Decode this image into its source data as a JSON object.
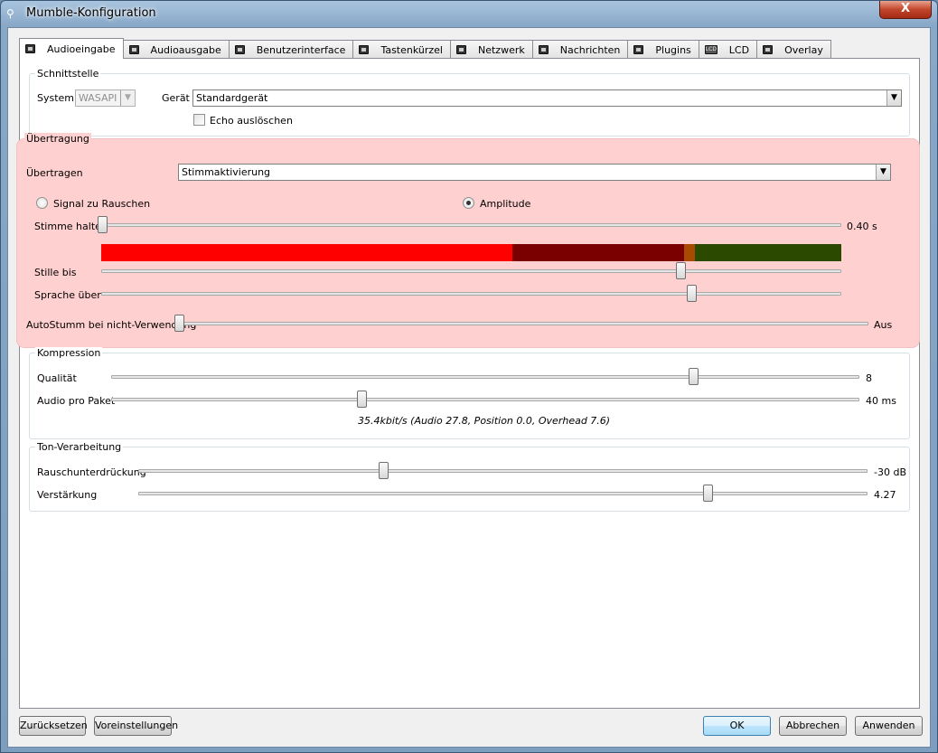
{
  "window": {
    "title": "Mumble-Konfiguration",
    "close_label": "X"
  },
  "tabs": [
    {
      "label": "Audioeingabe",
      "icon": "audio-input-icon"
    },
    {
      "label": "Audioausgabe",
      "icon": "audio-output-icon"
    },
    {
      "label": "Benutzerinterface",
      "icon": "window-icon"
    },
    {
      "label": "Tastenkürzel",
      "icon": "keyboard-icon"
    },
    {
      "label": "Netzwerk",
      "icon": "network-icon"
    },
    {
      "label": "Nachrichten",
      "icon": "messages-icon"
    },
    {
      "label": "Plugins",
      "icon": "plugin-icon"
    },
    {
      "label": "LCD",
      "icon": "lcd-icon",
      "icon_text": "LCD"
    },
    {
      "label": "Overlay",
      "icon": "overlay-icon"
    }
  ],
  "interface": {
    "title": "Schnittstelle",
    "system_label": "System",
    "system_value": "WASAPI",
    "device_label": "Gerät",
    "device_value": "Standardgerät",
    "echo_label": "Echo auslöschen",
    "echo_checked": false
  },
  "transmission": {
    "title": "Übertragung",
    "transmit_label": "Übertragen",
    "transmit_value": "Stimmaktivierung",
    "radio_snr": "Signal zu Rauschen",
    "radio_amplitude": "Amplitude",
    "selected": "amplitude",
    "hold_label": "Stimme halten",
    "hold_value": "0.40 s",
    "hold_fraction": 0.0,
    "vu_colors": [
      "#ff0000",
      "#7a0000",
      "#a84a00",
      "#2b4a00"
    ],
    "vu_stops": [
      0.555,
      0.788,
      0.802,
      1.0
    ],
    "silence_label": "Stille bis",
    "silence_fraction": 0.783,
    "speech_label": "Sprache über",
    "speech_fraction": 0.798,
    "automute_label": "AutoStumm bei nicht-Verwendung",
    "automute_value": "Aus",
    "automute_fraction": 0.0,
    "highlight_color": "#ffd0d0"
  },
  "compression": {
    "title": "Kompression",
    "quality_label": "Qualität",
    "quality_value": "8",
    "quality_fraction": 0.778,
    "packet_label": "Audio pro Paket",
    "packet_value": "40 ms",
    "packet_fraction": 0.334,
    "status": "35.4kbit/s (Audio 27.8, Position 0.0, Overhead 7.6)"
  },
  "processing": {
    "title": "Ton-Verarbeitung",
    "noise_label": "Rauschunterdrückung",
    "noise_value": "-30 dB",
    "noise_fraction": 0.336,
    "gain_label": "Verstärkung",
    "gain_value": "4.27",
    "gain_fraction": 0.781
  },
  "buttons": {
    "reset": "Zurücksetzen",
    "defaults": "Voreinstellungen",
    "ok": "OK",
    "cancel": "Abbrechen",
    "apply": "Anwenden"
  }
}
